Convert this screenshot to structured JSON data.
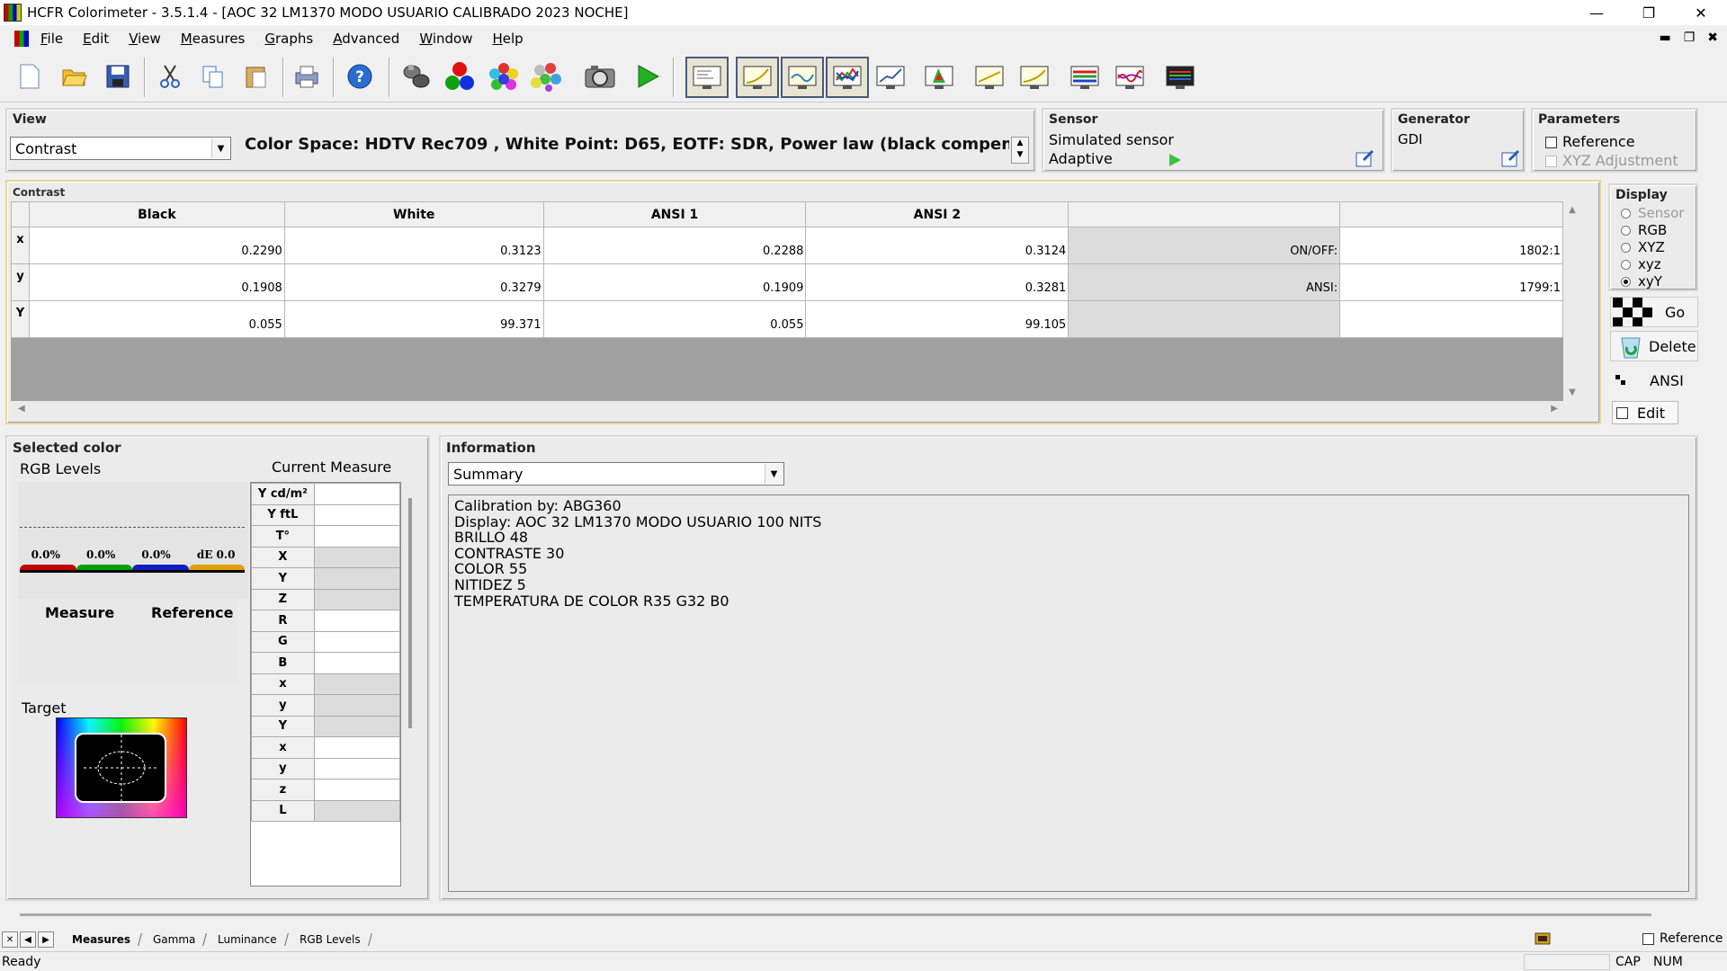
{
  "window": {
    "title": "HCFR Colorimeter - 3.5.1.4 - [AOC 32 LM1370 MODO USUARIO CALIBRADO 2023 NOCHE]"
  },
  "menu": [
    {
      "u": "F",
      "rest": "ile"
    },
    {
      "u": "E",
      "rest": "dit"
    },
    {
      "u": "V",
      "rest": "iew"
    },
    {
      "u": "M",
      "rest": "easures"
    },
    {
      "u": "G",
      "rest": "raphs"
    },
    {
      "u": "A",
      "rest": "dvanced"
    },
    {
      "u": "W",
      "rest": "indow"
    },
    {
      "u": "H",
      "rest": "elp"
    }
  ],
  "toolbar": [
    "new-icon",
    "open-icon",
    "save-icon",
    "cut-icon",
    "copy-icon",
    "paste-icon",
    "print-icon",
    "help-icon",
    "sensor-icon",
    "rgb-icon",
    "colors-icon",
    "palette-icon",
    "camera-icon",
    "play-icon",
    "view-icon",
    "gamma-graph-icon",
    "luminance-graph-icon",
    "rgb-graph-icon",
    "deltae-graph-icon",
    "cie-graph-icon",
    "graph-icon",
    "graph2-icon",
    "color-temp-icon",
    "spectrum-icon",
    "monitor-icon"
  ],
  "view": {
    "label": "View",
    "selected": "Contrast",
    "colorspace": "Color Space: HDTV Rec709 , White Point: D65, EOTF:  SDR, Power law (black compen..."
  },
  "sensor": {
    "label": "Sensor",
    "name": "Simulated sensor",
    "mode": "Adaptive"
  },
  "generator": {
    "label": "Generator",
    "name": "GDI"
  },
  "parameters": {
    "label": "Parameters",
    "reference": "Reference",
    "xyz_adjust": "XYZ Adjustment"
  },
  "contrast": {
    "label": "Contrast",
    "headers": [
      "Black",
      "White",
      "ANSI 1",
      "ANSI 2",
      "",
      ""
    ],
    "rows": [
      {
        "label": "x",
        "cells": [
          "0.2290",
          "0.3123",
          "0.2288",
          "0.3124",
          "ON/OFF:",
          "1802:1"
        ]
      },
      {
        "label": "y",
        "cells": [
          "0.1908",
          "0.3279",
          "0.1909",
          "0.3281",
          "ANSI:",
          "1799:1"
        ]
      },
      {
        "label": "Y",
        "cells": [
          "0.055",
          "99.371",
          "0.055",
          "99.105",
          "",
          ""
        ]
      }
    ]
  },
  "display": {
    "label": "Display",
    "options": [
      "Sensor",
      "RGB",
      "XYZ",
      "xyz",
      "xyY"
    ],
    "selected": "xyY",
    "go": "Go",
    "delete": "Delete",
    "ansi": "ANSI",
    "edit": "Edit"
  },
  "selected": {
    "label": "Selected color",
    "rgb_levels": "RGB Levels",
    "current": "Current Measure",
    "bars": [
      "0.0%",
      "0.0%",
      "0.0%",
      "dE 0.0"
    ],
    "measure": "Measure",
    "reference": "Reference",
    "target": "Target",
    "rows": [
      "Y cd/m²",
      "Y ftL",
      "T°",
      "X",
      "Y",
      "Z",
      "R",
      "G",
      "B",
      "x",
      "y",
      "Y",
      "x",
      "y",
      "z",
      "L"
    ]
  },
  "info": {
    "label": "Information",
    "selected": "Summary",
    "lines": [
      "Calibration by: ABG360",
      "Display: AOC 32 LM1370 MODO USUARIO 100 NITS",
      "BRILLO 48",
      "CONTRASTE 30",
      "COLOR 55",
      "NITIDEZ 5",
      "TEMPERATURA DE COLOR R35 G32 B0"
    ]
  },
  "tabs": [
    "Measures",
    "Gamma",
    "Luminance",
    "RGB Levels"
  ],
  "status": {
    "ready": "Ready",
    "cap": "CAP",
    "num": "NUM",
    "reference": "Reference"
  }
}
